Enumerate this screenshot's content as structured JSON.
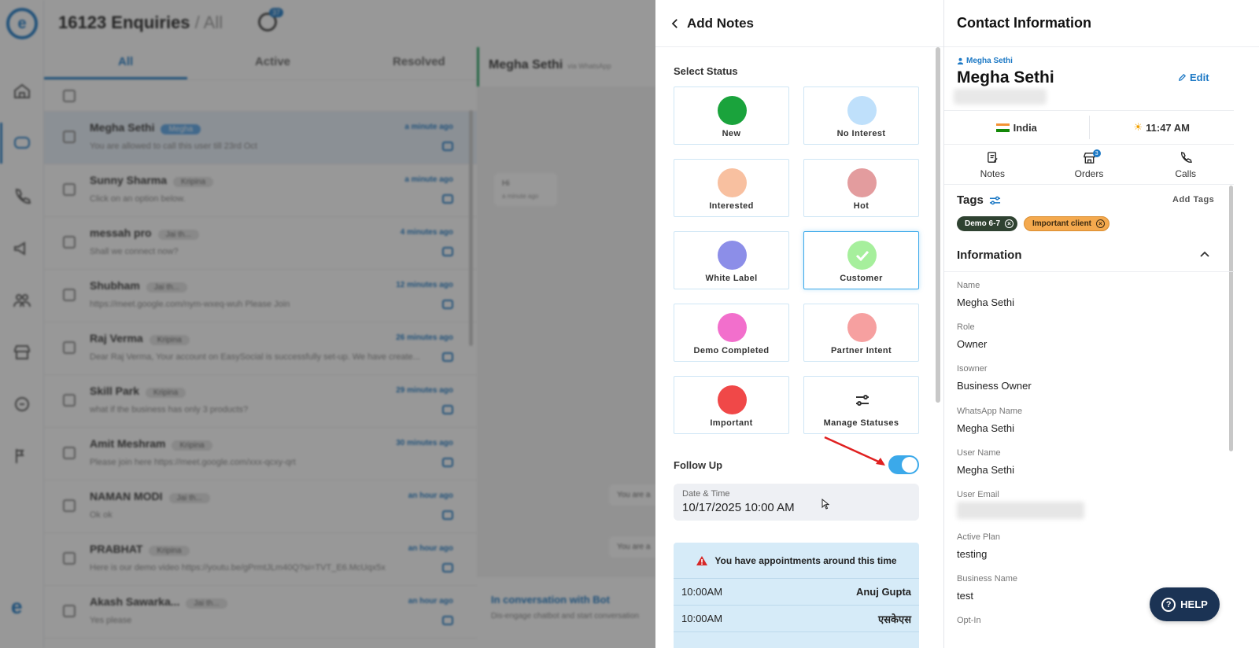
{
  "background_app": {
    "title": "16123 Enquiries",
    "title_suffix": "/ All",
    "timer_badge": "37",
    "tabs": [
      {
        "label": "All"
      },
      {
        "label": "Active"
      },
      {
        "label": "Resolved"
      }
    ],
    "conversations": [
      {
        "name": "Megha Sethi",
        "tag": "Megha",
        "time": "a minute ago",
        "preview": "You are allowed to call this user till 23rd Oct"
      },
      {
        "name": "Sunny Sharma",
        "tag": "Kripina",
        "time": "a minute ago",
        "preview": "Click on an option below."
      },
      {
        "name": "messah pro",
        "tag": "Jai th...",
        "time": "4 minutes ago",
        "preview": "Shall we connect now?"
      },
      {
        "name": "Shubham",
        "tag": "Jai th...",
        "time": "12 minutes ago",
        "preview": "https://meet.google.com/nym-wxeq-wuh Please Join"
      },
      {
        "name": "Raj Verma",
        "tag": "Kripina",
        "time": "26 minutes ago",
        "preview": "Dear Raj Verma, Your account on EasySocial is successfully set-up. We have create..."
      },
      {
        "name": "Skill Park",
        "tag": "Kripina",
        "time": "29 minutes ago",
        "preview": "what if the business has only 3 products?"
      },
      {
        "name": "Amit Meshram",
        "tag": "Kripina",
        "time": "30 minutes ago",
        "preview": "Please join here https://meet.google.com/xxx-qcxy-qrt"
      },
      {
        "name": "NAMAN MODI",
        "tag": "Jai th...",
        "time": "an hour ago",
        "preview": "Ok ok"
      },
      {
        "name": "PRABHAT",
        "tag": "Kripina",
        "time": "an hour ago",
        "preview": "Here is our demo video https://youtu.be/gPrmtJLm40Q?si=TVT_E6.McUqx5x"
      },
      {
        "name": "Akash Sawarka...",
        "tag": "Jai th...",
        "time": "an hour ago",
        "preview": "Yes please"
      }
    ],
    "chat": {
      "contact": "Megha Sethi",
      "via": "via WhatsApp",
      "bubble_text": "Hi",
      "bubble_time": "a minute ago",
      "bot_title": "In conversation with Bot",
      "bot_sub": "Dis-engage chatbot and start conversation",
      "msg_stub_1": "You are a",
      "msg_stub_2": "You are a"
    }
  },
  "notes_panel": {
    "title": "Add Notes",
    "select_status_label": "Select Status",
    "statuses": [
      {
        "label": "New",
        "color": "#1aa33c"
      },
      {
        "label": "No Interest",
        "color": "#bfe0fb"
      },
      {
        "label": "Interested",
        "color": "#f8c0a0"
      },
      {
        "label": "Hot",
        "color": "#e39c9e"
      },
      {
        "label": "White Label",
        "color": "#8c8ee8"
      },
      {
        "label": "Customer",
        "color": "#a6ef9c",
        "selected": true
      },
      {
        "label": "Demo Completed",
        "color": "#f26fcc"
      },
      {
        "label": "Partner Intent",
        "color": "#f6a0a0"
      },
      {
        "label": "Important",
        "color": "#f04848"
      },
      {
        "label": "Manage Statuses",
        "icon": "sliders-icon"
      }
    ],
    "follow_up_label": "Follow Up",
    "follow_up_enabled": true,
    "datetime_caption": "Date & Time",
    "datetime_value": "10/17/2025 10:00 AM",
    "appointments_warning": "You have appointments around this time",
    "appointments": [
      {
        "time": "10:00AM",
        "name": "Anuj Gupta"
      },
      {
        "time": "10:00AM",
        "name": "एसकेएस"
      }
    ],
    "accent": "#3ba9ea"
  },
  "contact_panel": {
    "title": "Contact Information",
    "owner_small": "Megha Sethi",
    "name": "Megha Sethi",
    "edit_label": "Edit",
    "country": "India",
    "local_time": "11:47 AM",
    "tabs": [
      {
        "label": "Notes"
      },
      {
        "label": "Orders",
        "badge": "3"
      },
      {
        "label": "Calls"
      }
    ],
    "tags_title": "Tags",
    "add_tags_label": "Add Tags",
    "tags": [
      {
        "label": "Demo 6-7"
      },
      {
        "label": "Important client"
      }
    ],
    "information_title": "Information",
    "fields": [
      {
        "key": "Name",
        "value": "Megha Sethi"
      },
      {
        "key": "Role",
        "value": "Owner"
      },
      {
        "key": "Isowner",
        "value": "Business Owner"
      },
      {
        "key": "WhatsApp Name",
        "value": "Megha Sethi"
      },
      {
        "key": "User Name",
        "value": "Megha Sethi"
      },
      {
        "key": "User Email",
        "value": ""
      },
      {
        "key": "Active Plan",
        "value": "testing"
      },
      {
        "key": "Business Name",
        "value": "test"
      },
      {
        "key": "Opt-In",
        "value": ""
      }
    ],
    "help_label": "HELP",
    "brand_color": "#1d79c5"
  }
}
